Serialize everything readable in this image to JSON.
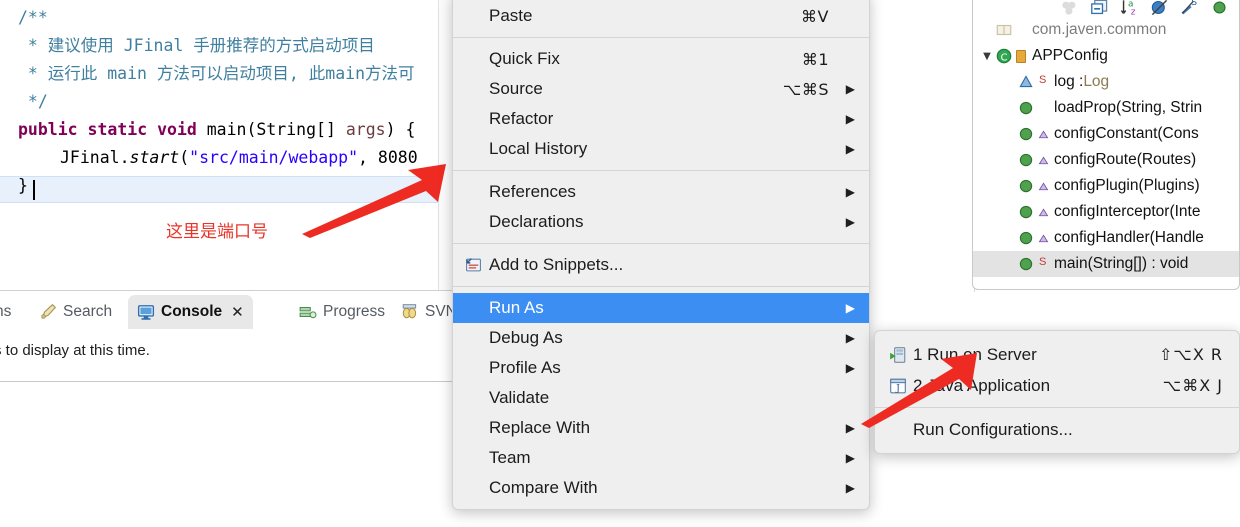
{
  "editor": {
    "lines": [
      {
        "indent": 0,
        "segments": [
          {
            "t": "/**",
            "c": "cl-comment"
          }
        ]
      },
      {
        "indent": 0,
        "segments": [
          {
            "t": " * 建议使用 JFinal 手册推荐的方式启动项目",
            "c": "cl-comment"
          }
        ]
      },
      {
        "indent": 0,
        "segments": [
          {
            "t": " * 运行此 main 方法可以启动项目, 此main方法可",
            "c": "cl-comment"
          }
        ]
      },
      {
        "indent": 0,
        "segments": [
          {
            "t": " */",
            "c": "cl-comment"
          }
        ]
      },
      {
        "indent": 0,
        "segments": [
          {
            "t": "public static void ",
            "c": "cl-kw"
          },
          {
            "t": "main",
            "c": "cl-plain"
          },
          {
            "t": "(String[] ",
            "c": "cl-plain"
          },
          {
            "t": "args",
            "c": "cl-param"
          },
          {
            "t": ") {",
            "c": "cl-plain"
          }
        ]
      },
      {
        "indent": 1,
        "segments": [
          {
            "t": "JFinal.",
            "c": "cl-plain"
          },
          {
            "t": "start",
            "c": "cl-plain cl-italic"
          },
          {
            "t": "(",
            "c": "cl-plain"
          },
          {
            "t": "\"src/main/webapp\"",
            "c": "cl-str"
          },
          {
            "t": ", 8080",
            "c": "cl-plain"
          }
        ]
      },
      {
        "indent": 0,
        "segments": [
          {
            "t": "}",
            "c": "cl-plain"
          }
        ]
      }
    ],
    "annotation": "这里是端口号",
    "annotation_color": "#e8352a",
    "arrow_color": "#ee2b22"
  },
  "bottom_panel": {
    "tabs": [
      {
        "label": "ns",
        "icon": "clipped-tab-icon",
        "active": false,
        "closable": false
      },
      {
        "label": "Search",
        "icon": "search-pencil-icon",
        "active": false,
        "closable": false
      },
      {
        "label": "Console",
        "icon": "console-monitor-icon",
        "active": true,
        "closable": true
      },
      {
        "label": "Progress",
        "icon": "progress-icon",
        "active": false,
        "closable": false
      },
      {
        "label": "SVN",
        "icon": "svn-repository-icon",
        "active": false,
        "closable": false
      }
    ],
    "close_glyph": "✕",
    "console_message": "s to display at this time."
  },
  "context_menu": {
    "items": [
      {
        "label": "Paste",
        "shortcut": "⌘V",
        "submenu": false,
        "selected": false,
        "icon": null
      },
      {
        "separator": true
      },
      {
        "label": "Quick Fix",
        "shortcut": "⌘1",
        "submenu": false,
        "selected": false,
        "icon": null
      },
      {
        "label": "Source",
        "shortcut": "⌥⌘S",
        "submenu": true,
        "selected": false,
        "icon": null
      },
      {
        "label": "Refactor",
        "shortcut": "",
        "submenu": true,
        "selected": false,
        "icon": null
      },
      {
        "label": "Local History",
        "shortcut": "",
        "submenu": true,
        "selected": false,
        "icon": null
      },
      {
        "separator": true
      },
      {
        "label": "References",
        "shortcut": "",
        "submenu": true,
        "selected": false,
        "icon": null
      },
      {
        "label": "Declarations",
        "shortcut": "",
        "submenu": true,
        "selected": false,
        "icon": null
      },
      {
        "separator": true
      },
      {
        "label": "Add to Snippets...",
        "shortcut": "",
        "submenu": false,
        "selected": false,
        "icon": "snippets-icon"
      },
      {
        "separator": true
      },
      {
        "label": "Run As",
        "shortcut": "",
        "submenu": true,
        "selected": true,
        "icon": null
      },
      {
        "label": "Debug As",
        "shortcut": "",
        "submenu": true,
        "selected": false,
        "icon": null
      },
      {
        "label": "Profile As",
        "shortcut": "",
        "submenu": true,
        "selected": false,
        "icon": null
      },
      {
        "label": "Validate",
        "shortcut": "",
        "submenu": false,
        "selected": false,
        "icon": null
      },
      {
        "label": "Replace With",
        "shortcut": "",
        "submenu": true,
        "selected": false,
        "icon": null
      },
      {
        "label": "Team",
        "shortcut": "",
        "submenu": true,
        "selected": false,
        "icon": null
      },
      {
        "label": "Compare With",
        "shortcut": "",
        "submenu": true,
        "selected": false,
        "icon": null
      }
    ],
    "submenu_arrow_glyph": "▶",
    "highlight_color": "#3d8ef2"
  },
  "run_as_submenu": {
    "items": [
      {
        "label": "1 Run on Server",
        "shortcut": "⇧⌥X R",
        "icon": "run-on-server-icon"
      },
      {
        "label": "2 Java Application",
        "shortcut": "⌥⌘X J",
        "icon": "java-application-icon"
      },
      {
        "separator": true
      },
      {
        "label": "Run Configurations...",
        "shortcut": "",
        "icon": null
      }
    ]
  },
  "outline": {
    "toolbar_icons": [
      "hide-fields-icon",
      "collapse-all-icon",
      "sort-alphabetically-icon",
      "hide-non-public-icon",
      "hide-static-icon",
      "hide-local-types-icon"
    ],
    "rows": [
      {
        "indent": 0,
        "twisty": "",
        "icon": "package-icon",
        "modifier": "",
        "label": "com.javen.common",
        "type": "",
        "selected": false,
        "clipped": true
      },
      {
        "indent": 0,
        "twisty": "▼",
        "icon": "class-icon",
        "modifier": "deprecated-marker",
        "label": "APPConfig",
        "type": "",
        "selected": false,
        "clipped": false
      },
      {
        "indent": 1,
        "twisty": "",
        "icon": "field-icon",
        "modifier": "static-s",
        "label": "log : ",
        "type": "Log",
        "selected": false,
        "clipped": false
      },
      {
        "indent": 1,
        "twisty": "",
        "icon": "method-icon",
        "modifier": "",
        "label": "loadProp(String, Strin",
        "type": "",
        "selected": false,
        "clipped": true
      },
      {
        "indent": 1,
        "twisty": "",
        "icon": "method-icon",
        "modifier": "override-marker",
        "label": "configConstant(Cons",
        "type": "",
        "selected": false,
        "clipped": true
      },
      {
        "indent": 1,
        "twisty": "",
        "icon": "method-icon",
        "modifier": "override-marker",
        "label": "configRoute(Routes)",
        "type": "",
        "selected": false,
        "clipped": false
      },
      {
        "indent": 1,
        "twisty": "",
        "icon": "method-icon",
        "modifier": "override-marker",
        "label": "configPlugin(Plugins)",
        "type": "",
        "selected": false,
        "clipped": false
      },
      {
        "indent": 1,
        "twisty": "",
        "icon": "method-icon",
        "modifier": "override-marker",
        "label": "configInterceptor(Inte",
        "type": "",
        "selected": false,
        "clipped": true
      },
      {
        "indent": 1,
        "twisty": "",
        "icon": "method-icon",
        "modifier": "override-marker",
        "label": "configHandler(Handle",
        "type": "",
        "selected": false,
        "clipped": true
      },
      {
        "indent": 1,
        "twisty": "",
        "icon": "method-icon",
        "modifier": "static-s",
        "label": "main(String[]) : void",
        "type": "",
        "selected": true,
        "clipped": false
      }
    ]
  }
}
